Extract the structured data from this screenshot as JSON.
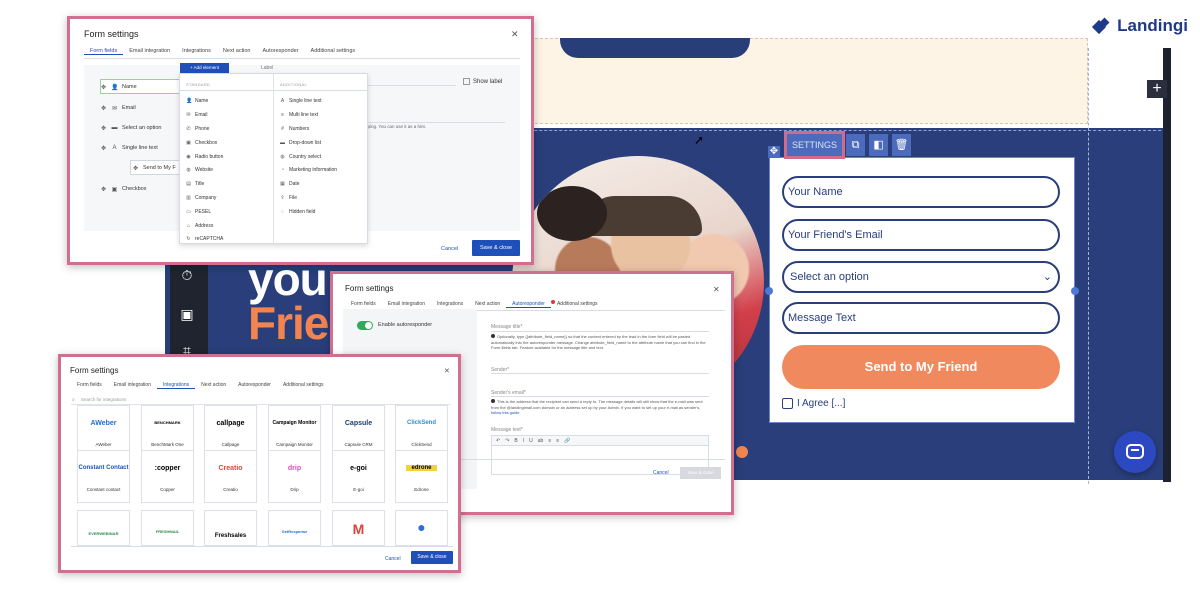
{
  "logo": {
    "text": "Landingi"
  },
  "page_preview": {
    "hero_line1": "you",
    "hero_line2": "Frie",
    "toolbar": {
      "settings_label": "SETTINGS"
    },
    "form": {
      "name_placeholder": "Your Name",
      "friend_email_placeholder": "Your Friend's Email",
      "select_value": "Select an option",
      "message_placeholder": "Message Text",
      "submit_label": "Send to My Friend",
      "agree_label": "I Agree [...]"
    }
  },
  "dialog_form_fields": {
    "title": "Form settings",
    "tabs": [
      "Form fields",
      "Email integration",
      "Integrations",
      "Next action",
      "Autoresponder",
      "Additional settings"
    ],
    "active_tab": "Form fields",
    "add_element_label": "+ Add element",
    "label_caption": "Label",
    "show_label": "Show label",
    "hint_text": "pping. You can use it as a hint.",
    "fields": [
      {
        "icon": "user-icon",
        "label": "Name"
      },
      {
        "icon": "mail-icon",
        "label": "Email"
      },
      {
        "icon": "list-icon",
        "label": "Select an option"
      },
      {
        "icon": "text-icon",
        "label": "Single line text"
      },
      {
        "icon": "button-icon",
        "label": "Send to My F"
      },
      {
        "icon": "checkbox-icon",
        "label": "Checkbox"
      }
    ],
    "dropdown": {
      "standard_header": "STANDARD",
      "additional_header": "ADDITIONAL",
      "standard": [
        "Name",
        "Email",
        "Phone",
        "Checkbox",
        "Radio button",
        "Website",
        "Title",
        "Company",
        "PESEL",
        "Address",
        "reCAPTCHA"
      ],
      "additional": [
        "Single line text",
        "Multi line text",
        "Numbers",
        "Drop-down list",
        "Country select",
        "Marketing information",
        "Date",
        "File",
        "Hidden field"
      ]
    },
    "cancel_label": "Cancel",
    "save_label": "Save & close"
  },
  "dialog_autoresponder": {
    "title": "Form settings",
    "tabs": [
      "Form fields",
      "Email integration",
      "Integrations",
      "Next action",
      "Autoresponder",
      "Additional settings"
    ],
    "active_tab": "Autoresponder",
    "toggle_label": "Enable autoresponder",
    "message_title_label": "Message title*",
    "message_title_help": "Optionally, type {{attribute_field_name}} so that the content entered by the lead in the form field will be pasted automatically into the autoresponder message. Change attribute_field_name to the attribute name that you can find in the Form fields tab. Feature available for the message title and text.",
    "sender_label": "Sender*",
    "sender_email_label": "Sender's email*",
    "sender_email_help": "This is the address that the recipient can send a reply to. The message details will still show that the e-mail was sent from the @landingimail.com domain or an address set up by your Admin. If you want to set up your e-mail as sender's,",
    "sender_email_link": "follow this guide",
    "message_text_label": "Message text*",
    "editor_tools": [
      "↶",
      "↷",
      "B",
      "I",
      "U",
      "ab",
      "≡",
      "≡",
      "🔗"
    ],
    "cancel_label": "Cancel",
    "save_label": "Save & close"
  },
  "dialog_integrations": {
    "title": "Form settings",
    "tabs": [
      "Form fields",
      "Email integration",
      "Integrations",
      "Next action",
      "Autoresponder",
      "Additional settings"
    ],
    "active_tab": "Integrations",
    "search_placeholder": "Search for integrations",
    "tiles_row1": [
      {
        "logo": "AWeber",
        "name": "AWeber",
        "color": "#1d6fd1"
      },
      {
        "logo": "BENCHMARK",
        "name": "BenchMark One",
        "color": "#333333"
      },
      {
        "logo": "callpage",
        "name": "Callpage",
        "color": "#222222"
      },
      {
        "logo": "Campaign Monitor",
        "name": "Campaign Monitor",
        "color": "#222222"
      },
      {
        "logo": "Capsule",
        "name": "Capsule CRM",
        "color": "#1a3d6e"
      },
      {
        "logo": "ClickSend",
        "name": "ClickSend",
        "color": "#2b8fd6"
      }
    ],
    "tiles_row2": [
      {
        "logo": "Constant Contact",
        "name": "Constant contact",
        "color": "#1856a8"
      },
      {
        "logo": ":copper",
        "name": "Copper",
        "color": "#222222"
      },
      {
        "logo": "Creatio",
        "name": "Creatio",
        "color": "#e2433c"
      },
      {
        "logo": "drip",
        "name": "Drip",
        "color": "#d94fb5"
      },
      {
        "logo": "e-goi",
        "name": "E-goi",
        "color": "#222222"
      },
      {
        "logo": "edrone",
        "name": "Edrone",
        "color": "#333333"
      }
    ],
    "tiles_row3": [
      {
        "logo": "EVERWEBINAR",
        "name": "",
        "color": "#2e8a4b"
      },
      {
        "logo": "FRESHMAIL",
        "name": "",
        "color": "#2e8a4b"
      },
      {
        "logo": "Freshsales",
        "name": "",
        "color": "#222222"
      },
      {
        "logo": "GetResponse",
        "name": "",
        "color": "#1e6fd6"
      },
      {
        "logo": "M",
        "name": "",
        "color": "#d6453c"
      },
      {
        "logo": "●",
        "name": "",
        "color": "#2a6fd6"
      }
    ],
    "cancel_label": "Cancel",
    "save_label": "Save & close"
  }
}
